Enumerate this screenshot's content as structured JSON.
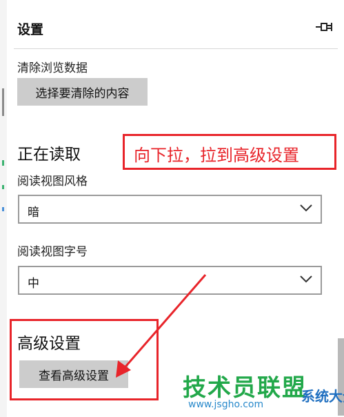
{
  "panel": {
    "title": "设置",
    "pin_icon": "pin-icon"
  },
  "clear_browsing": {
    "label": "清除浏览数据",
    "button_label": "选择要清除的内容"
  },
  "reading": {
    "section_title": "正在读取",
    "style_label": "阅读视图风格",
    "style_value": "暗",
    "font_size_label": "阅读视图字号",
    "font_size_value": "中"
  },
  "advanced": {
    "section_title": "高级设置",
    "button_label": "查看高级设置"
  },
  "annotation": {
    "text": "向下拉，拉到高级设置",
    "color": "#e8242a"
  },
  "watermark": {
    "brand": "技术员联盟",
    "url": "www.jsgho.com",
    "side_text": "系统大全"
  },
  "colors": {
    "button_bg": "#cccccc",
    "select_border": "#9a9a9a"
  }
}
